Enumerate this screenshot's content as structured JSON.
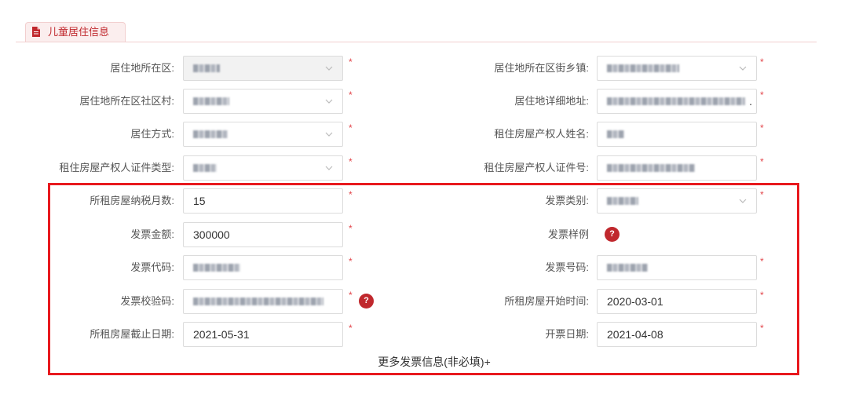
{
  "section_tab": {
    "title": "儿童居住信息",
    "icon": "document-icon"
  },
  "required_mark": "*",
  "help_icon": {
    "icon": "help-icon",
    "glyph": "?"
  },
  "colors": {
    "accent": "#c0282d",
    "highlight_box": "#e8191e",
    "required": "#e2454a",
    "tab_bg": "#fbeeee",
    "label_text": "#555555",
    "value_text": "#333333"
  },
  "residence": {
    "district": {
      "label": "居住地所在区:",
      "disabled": true
    },
    "street": {
      "label": "居住地所在区街乡镇:"
    },
    "community": {
      "label": "居住地所在区社区村:"
    },
    "address": {
      "label": "居住地详细地址:",
      "value_tail": "."
    },
    "mode": {
      "label": "居住方式:"
    },
    "owner_name": {
      "label": "租住房屋产权人姓名:"
    },
    "owner_id_type": {
      "label": "租住房屋产权人证件类型:"
    },
    "owner_id_number": {
      "label": "租住房屋产权人证件号:"
    }
  },
  "invoice": {
    "tax_months": {
      "label": "所租房屋纳税月数:",
      "value": "15"
    },
    "category": {
      "label": "发票类别:"
    },
    "amount": {
      "label": "发票金额:",
      "value": "300000"
    },
    "sample": {
      "label": "发票样例"
    },
    "code": {
      "label": "发票代码:"
    },
    "number": {
      "label": "发票号码:"
    },
    "check_code": {
      "label": "发票校验码:"
    },
    "rent_start": {
      "label": "所租房屋开始时间:",
      "value": "2020-03-01"
    },
    "rent_end": {
      "label": "所租房屋截止日期:",
      "value": "2021-05-31"
    },
    "issue_date": {
      "label": "开票日期:",
      "value": "2021-04-08"
    },
    "more_link": "更多发票信息(非必填)+"
  }
}
